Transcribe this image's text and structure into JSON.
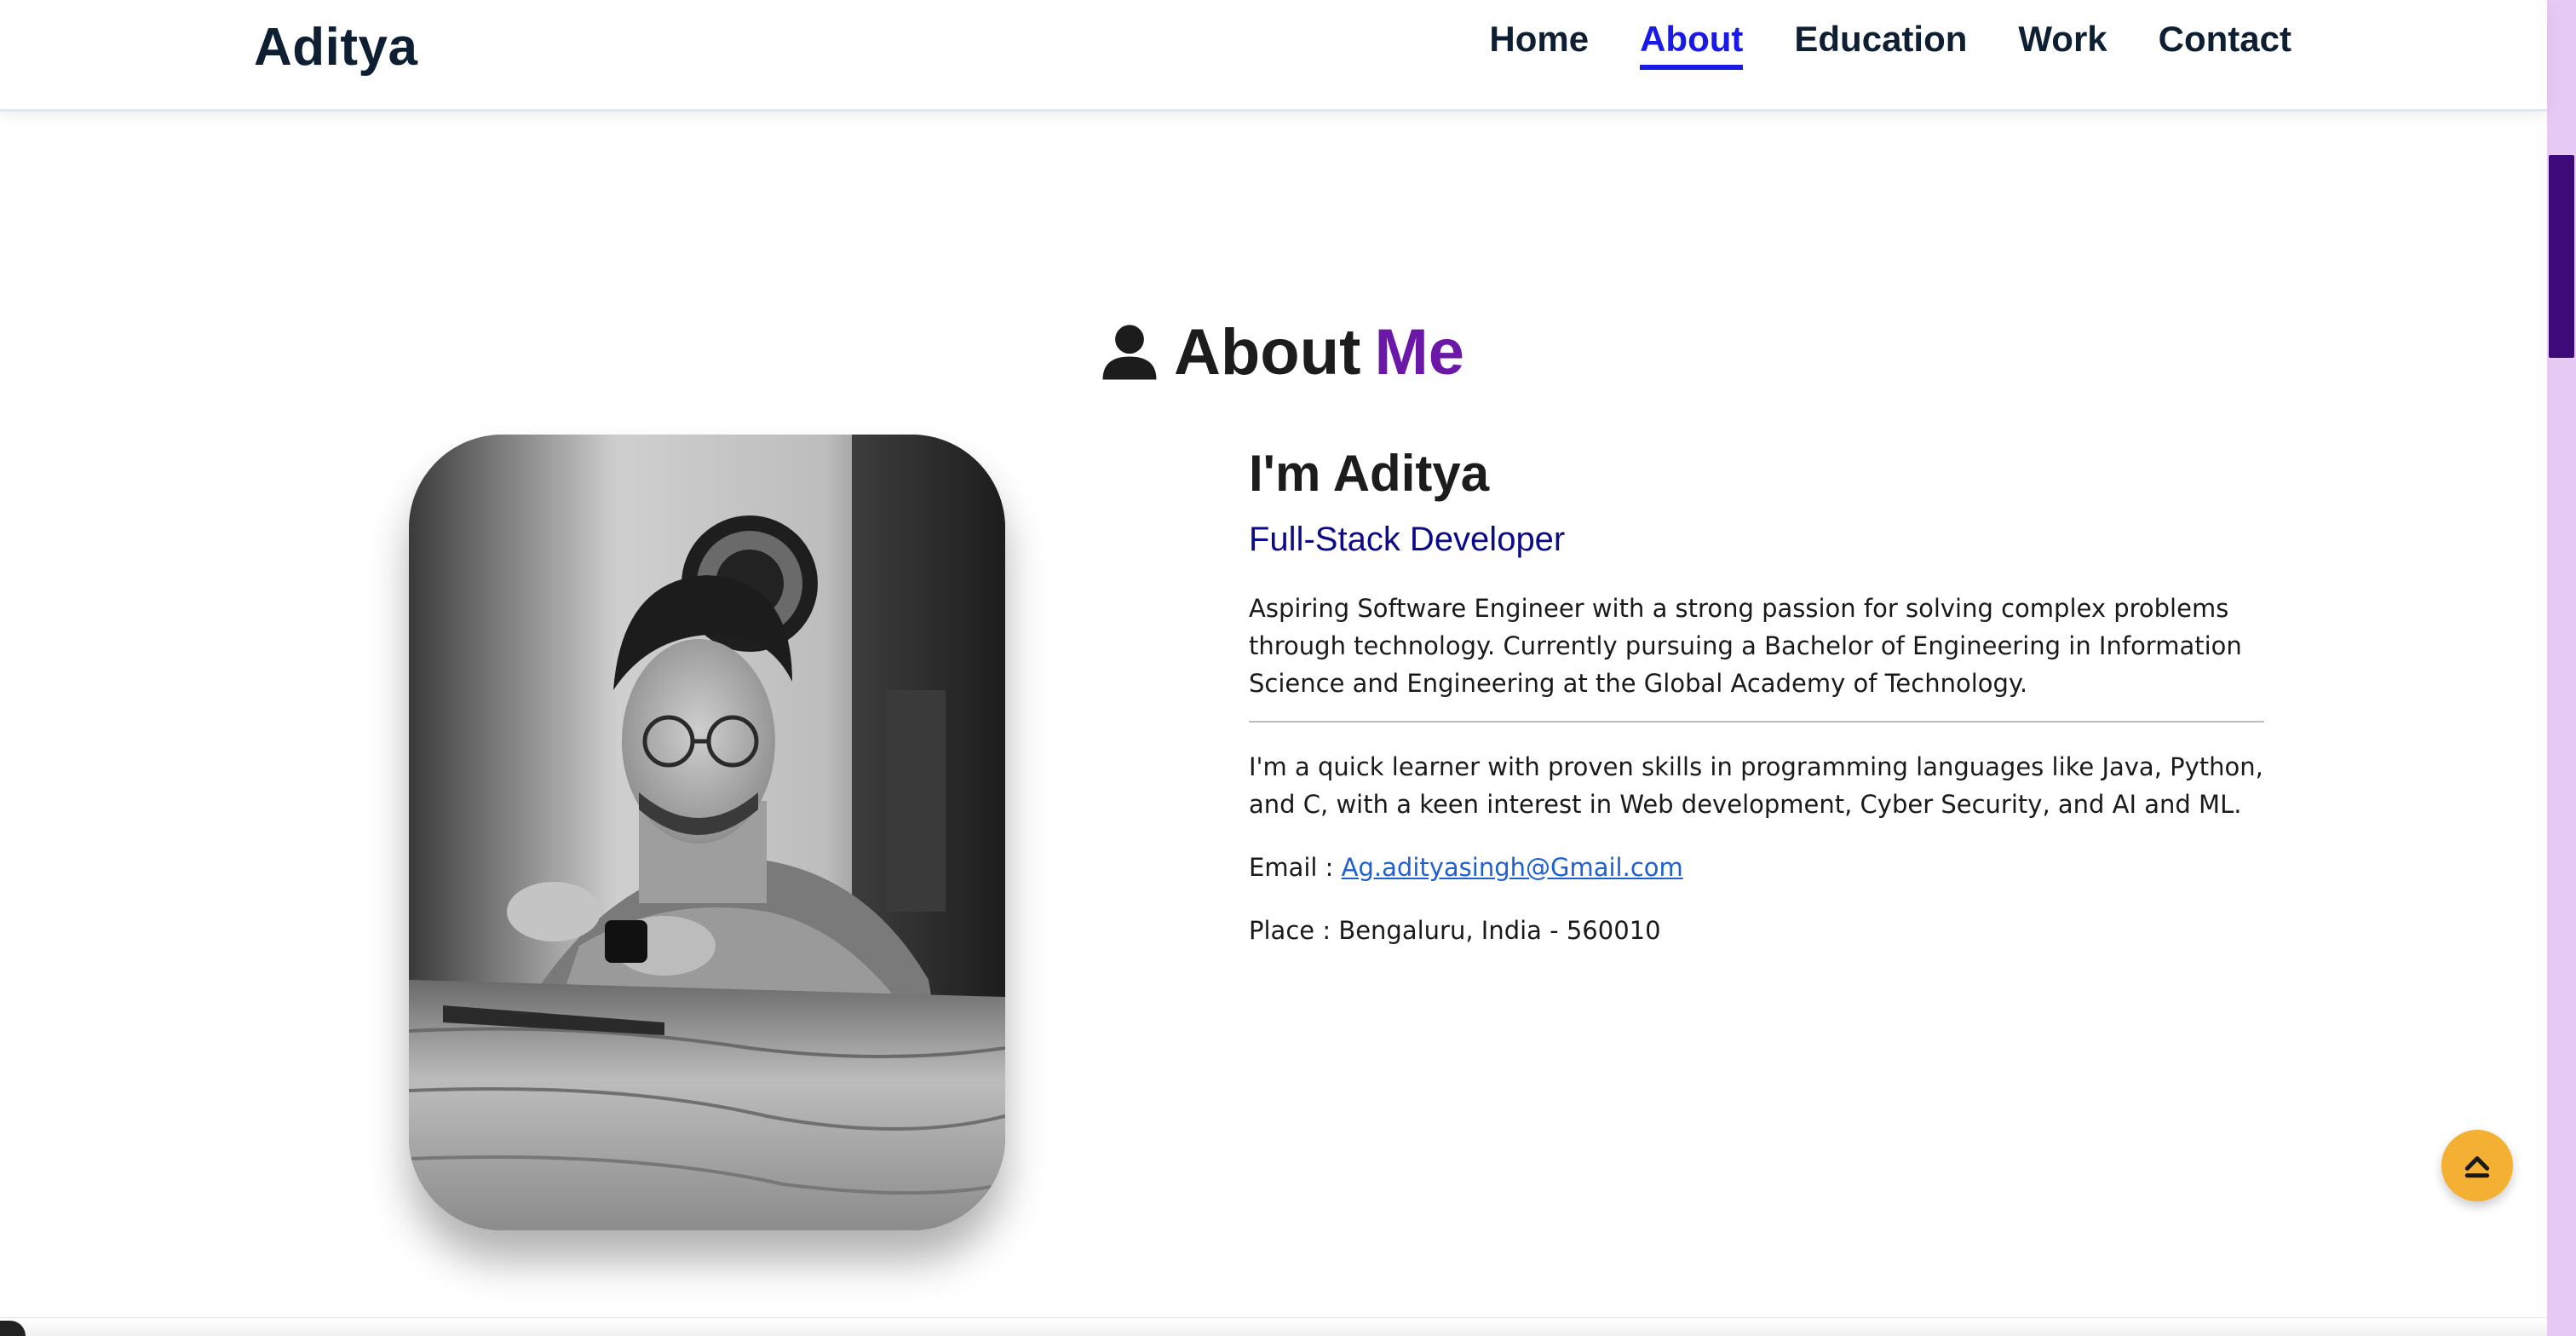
{
  "header": {
    "brand": "Aditya",
    "nav": [
      {
        "label": "Home",
        "active": false
      },
      {
        "label": "About",
        "active": true
      },
      {
        "label": "Education",
        "active": false
      },
      {
        "label": "Work",
        "active": false
      },
      {
        "label": "Contact",
        "active": false
      }
    ]
  },
  "about": {
    "title_main": "About",
    "title_accent": "Me",
    "title_icon": "user-icon",
    "name": "I'm Aditya",
    "role": "Full-Stack Developer",
    "paragraph1": "Aspiring Software Engineer with a strong passion for solving complex problems through technology. Currently pursuing a Bachelor of Engineering in Information Science and Engineering at the Global Academy of Technology.",
    "paragraph2": "I'm a quick learner with proven skills in programming languages like Java, Python, and C, with a keen interest in Web development, Cyber Security, and AI and ML.",
    "email_label": "Email : ",
    "email": "Ag.adityasingh@Gmail.com",
    "place_label": "Place : ",
    "place": "Bengaluru, India - 560010"
  },
  "scroll_top": {
    "icon": "chevron-up-icon"
  },
  "colors": {
    "accent_purple": "#6b18a8",
    "nav_active": "#1a1ae6",
    "role_color": "#0b0b8a",
    "scroll_top_bg": "#f4b032",
    "scrollbar_track": "#e6caf4",
    "scrollbar_thumb": "#3d0a7a"
  }
}
